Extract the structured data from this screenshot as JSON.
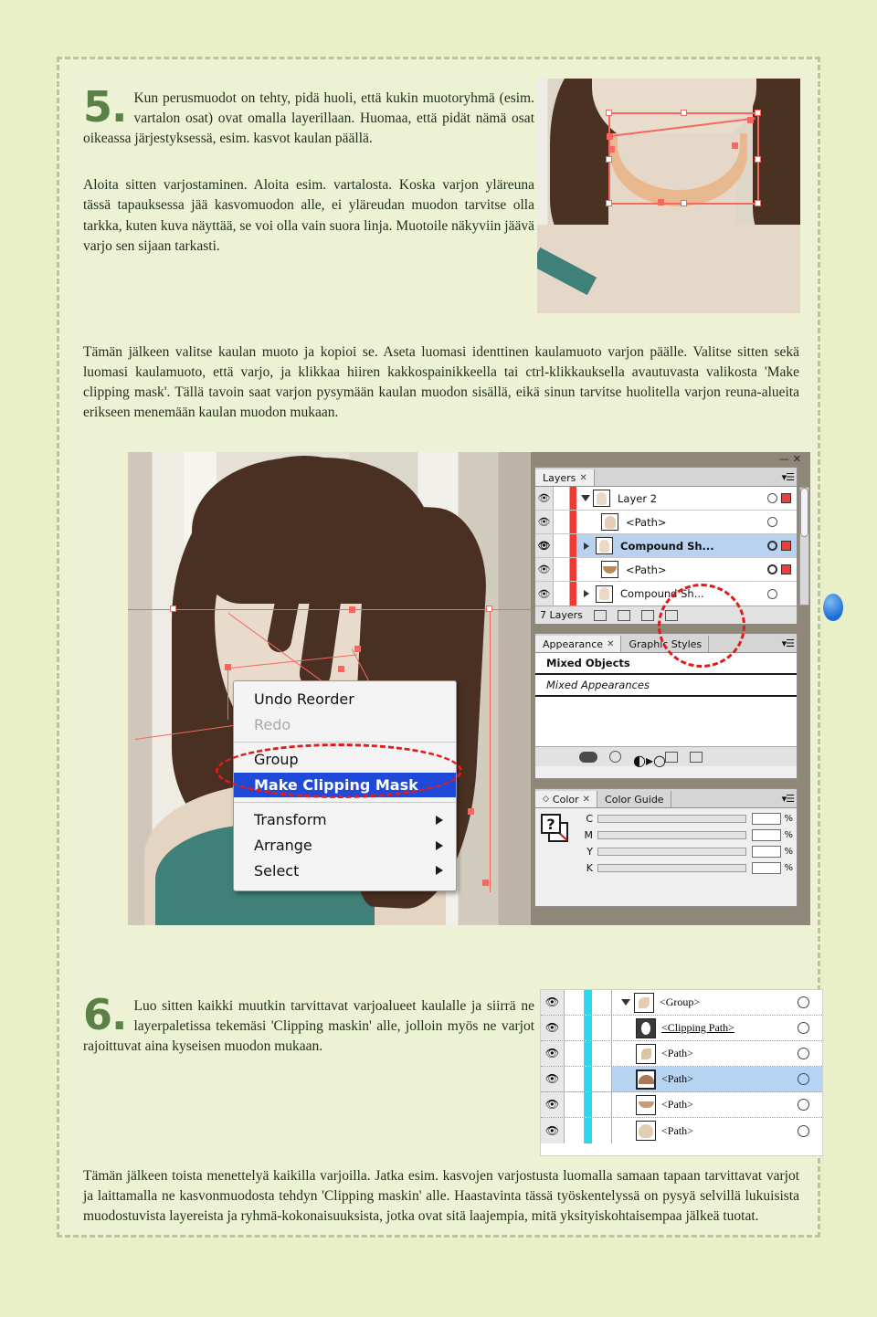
{
  "document": {
    "language": "fi",
    "page_bg": "#e9efc9",
    "sheet_bg": "#edf2d5",
    "accent_green": "#5a8247",
    "annotation_red": "#e01b1b"
  },
  "step5": {
    "number": "5.",
    "paragraph1": "Kun perusmuodot on tehty, pidä huoli, että kukin muotoryhmä (esim. vartalon osat) ovat omalla layerillaan. Huomaa, että pidät nämä osat oikeassa järjestyksessä, esim. kasvot kaulan päällä.",
    "paragraph2": "Aloita sitten varjostaminen. Aloita esim. vartalosta. Koska varjon yläreuna tässä tapauksessa jää kasvomuodon alle, ei yläreudan muodon tarvitse olla tarkka, kuten kuva näyttää, se voi olla vain suora linja. Muotoile näkyviin jäävä varjo sen sijaan tarkasti.",
    "paragraph3": "Tämän jälkeen valitse kaulan muoto ja kopioi se. Aseta luomasi identtinen kaulamuoto varjon päälle. Valitse sitten sekä luomasi kaulamuoto, että varjo, ja klikkaa hiiren kakkospainikkeella tai ctrl-klikkauksella avautuvasta valikosta 'Make clipping mask'. Tällä tavoin saat varjon pysymään kaulan muodon sisällä, eikä sinun tarvitse huolitella varjon reuna-alueita erikseen menemään kaulan muodon mukaan."
  },
  "step6": {
    "number": "6.",
    "paragraph1": "Luo sitten kaikki muutkin tarvittavat varjoalueet kaulalle ja siirrä ne layerpaletissa tekemäsi 'Clipping maskin' alle, jolloin myös ne varjot rajoittuvat aina kyseisen muodon mukaan.",
    "paragraph2": "Tämän jälkeen toista menettelyä kaikilla varjoilla. Jatka esim. kasvojen varjostusta luomalla samaan tapaan tarvittavat varjot ja laittamalla ne kasvonmuodosta tehdyn 'Clipping maskin' alle. Haastavinta tässä työskentelyssä on pysyä selvillä lukuisista muodostuvista layereista ja ryhmä-kokonaisuuksista, jotka ovat sitä laajempia, mitä yksityiskohtaisempaa jälkeä tuotat."
  },
  "screenshot_top": {
    "caption": "neck shadow selection with bounding box and anchor points"
  },
  "app_screenshot": {
    "context_menu": {
      "items": [
        {
          "label": "Undo Reorder",
          "state": "normal",
          "submenu": false
        },
        {
          "label": "Redo",
          "state": "disabled",
          "submenu": false
        },
        {
          "label": "Group",
          "state": "normal",
          "submenu": false
        },
        {
          "label": "Make Clipping Mask",
          "state": "selected",
          "submenu": false
        },
        {
          "label": "Transform",
          "state": "normal",
          "submenu": true
        },
        {
          "label": "Arrange",
          "state": "normal",
          "submenu": true
        },
        {
          "label": "Select",
          "state": "normal",
          "submenu": true
        }
      ]
    },
    "layers_panel": {
      "tab_label": "Layers",
      "tab_close": "✕",
      "menu_glyph": "▾☰",
      "minimize_glyph": "—",
      "close_glyph": "✕",
      "rows": [
        {
          "name": "Layer 2",
          "indent": 0,
          "expanded": true,
          "selected": false,
          "has_swatch": true,
          "target": "single"
        },
        {
          "name": "<Path>",
          "indent": 1,
          "expanded": false,
          "selected": false,
          "has_swatch": false,
          "target": "single"
        },
        {
          "name": "Compound Sh...",
          "indent": 1,
          "expanded": false,
          "selected": true,
          "has_swatch": true,
          "target": "double"
        },
        {
          "name": "<Path>",
          "indent": 1,
          "expanded": false,
          "selected": false,
          "has_swatch": true,
          "target": "double"
        },
        {
          "name": "Compound Sh...",
          "indent": 1,
          "expanded": false,
          "selected": false,
          "has_swatch": false,
          "target": "single"
        }
      ],
      "footer_count": "7 Layers"
    },
    "appearance_panel": {
      "tabs": [
        {
          "label": "Appearance",
          "active": true,
          "closable": true
        },
        {
          "label": "Graphic Styles",
          "active": false,
          "closable": false
        }
      ],
      "rows": [
        {
          "label": "Mixed Objects",
          "style": "bold"
        },
        {
          "label": "Mixed Appearances",
          "style": "italic"
        }
      ]
    },
    "color_panel": {
      "tabs": [
        {
          "label": "Color",
          "active": true,
          "closable": true
        },
        {
          "label": "Color Guide",
          "active": false,
          "closable": false
        }
      ],
      "fill_glyph": "?",
      "channels": [
        {
          "label": "C",
          "value": "",
          "unit": "%"
        },
        {
          "label": "M",
          "value": "",
          "unit": "%"
        },
        {
          "label": "Y",
          "value": "",
          "unit": "%"
        },
        {
          "label": "K",
          "value": "",
          "unit": "%"
        }
      ]
    }
  },
  "mini_layers": {
    "rows": [
      {
        "name": "<Group>",
        "indent": 0,
        "expanded": true,
        "selected": false,
        "underline": false
      },
      {
        "name": "<Clipping Path>",
        "indent": 1,
        "expanded": false,
        "selected": false,
        "underline": true
      },
      {
        "name": "<Path>",
        "indent": 1,
        "expanded": false,
        "selected": false,
        "underline": false
      },
      {
        "name": "<Path>",
        "indent": 1,
        "expanded": false,
        "selected": true,
        "underline": false
      },
      {
        "name": "<Path>",
        "indent": 1,
        "expanded": false,
        "selected": false,
        "underline": false
      },
      {
        "name": "<Path>",
        "indent": 1,
        "expanded": false,
        "selected": false,
        "underline": false
      }
    ]
  }
}
